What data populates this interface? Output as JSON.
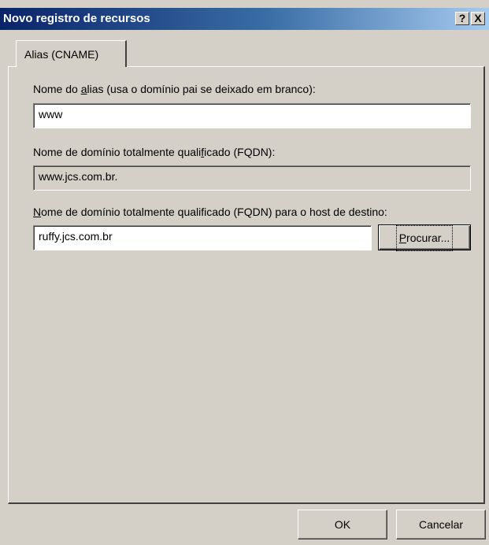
{
  "window": {
    "title": "Novo registro de recursos",
    "help_glyph": "?",
    "close_glyph": "X"
  },
  "tabs": [
    {
      "label": "Alias (CNAME)",
      "selected": true
    }
  ],
  "form": {
    "alias": {
      "label_pre": "Nome do ",
      "label_accel": "a",
      "label_post": "lias (usa o domínio pai se deixado em branco):",
      "value": "www"
    },
    "fqdn": {
      "label_pre": "Nome de domínio totalmente quali",
      "label_accel": "f",
      "label_post": "icado (FQDN):",
      "value": "www.jcs.com.br."
    },
    "target": {
      "label_pre": "",
      "label_accel": "N",
      "label_post": "ome de domínio totalmente qualificado (FQDN) para o host de destino:",
      "value": "ruffy.jcs.com.br"
    },
    "browse_button": {
      "label_accel": "P",
      "label_post": "rocurar..."
    }
  },
  "footer": {
    "ok_label": "OK",
    "cancel_label": "Cancelar"
  }
}
